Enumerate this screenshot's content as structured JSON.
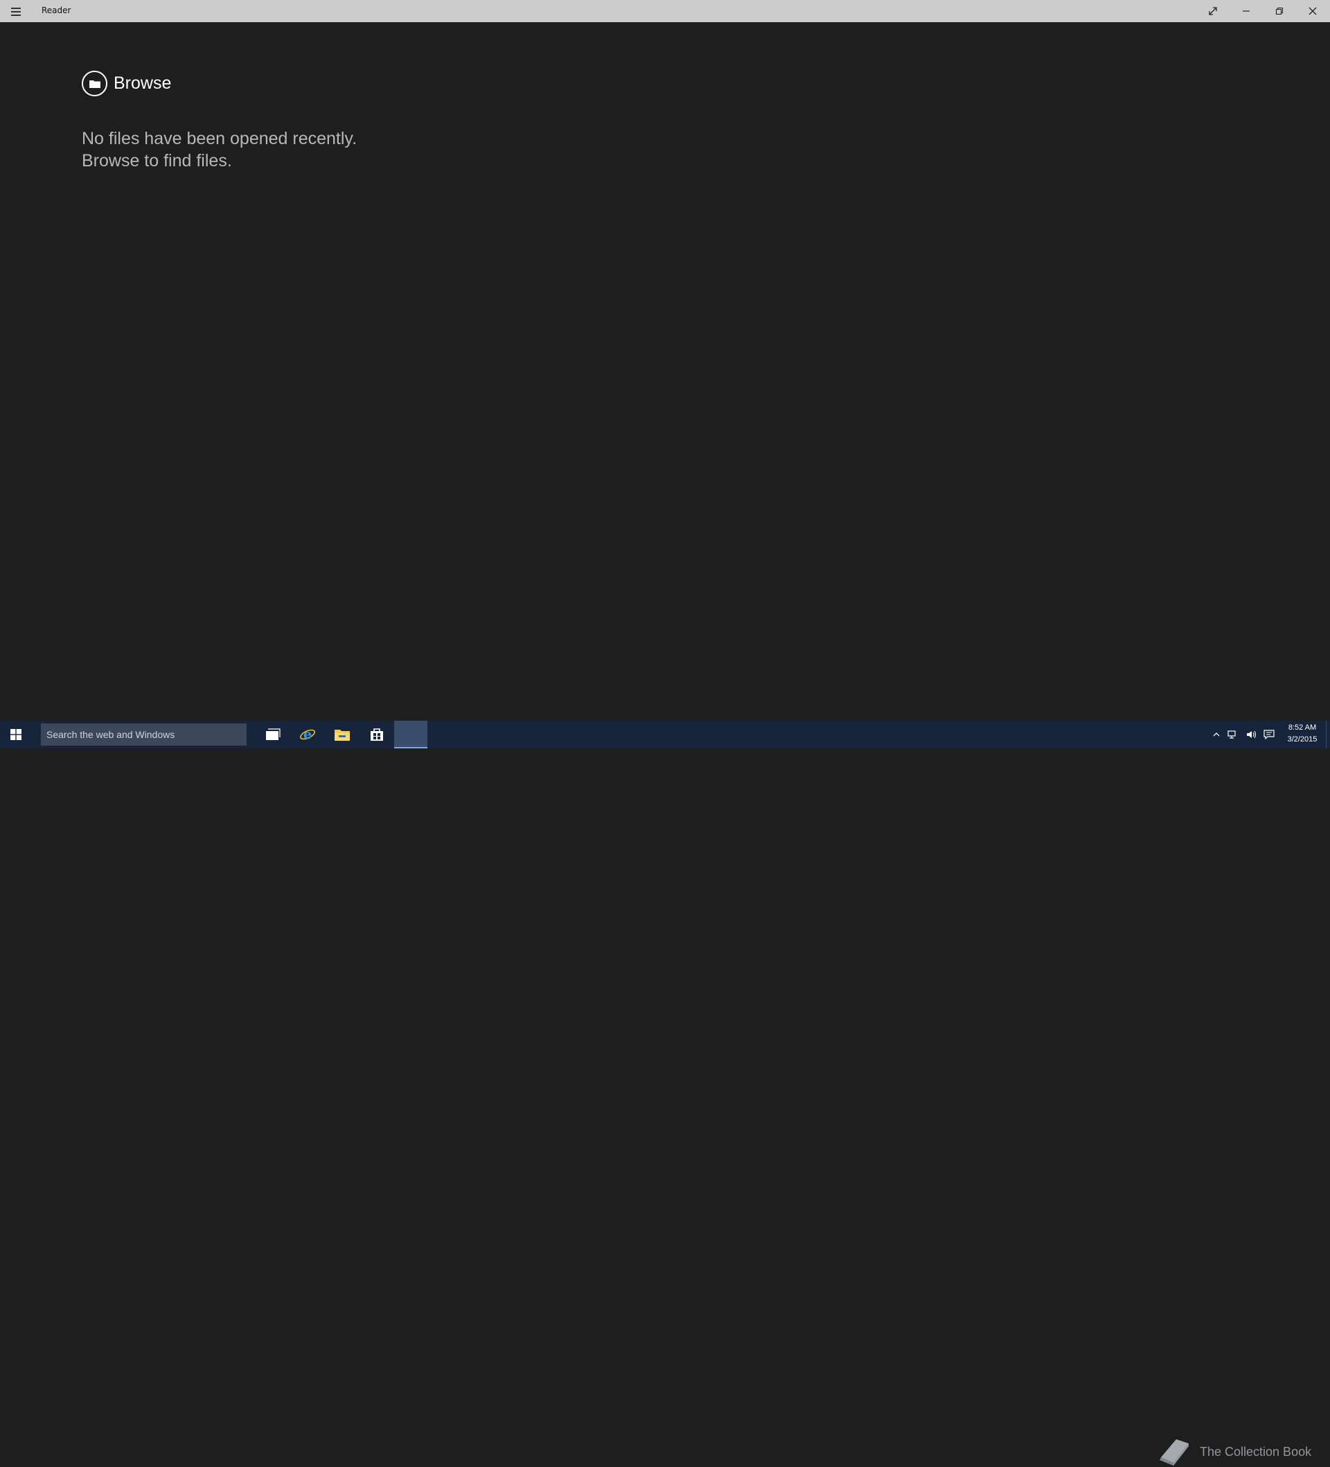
{
  "window": {
    "title": "Reader",
    "controls": {
      "fullscreen_icon": "expand-icon",
      "minimize_icon": "minimize-icon",
      "restore_icon": "restore-icon",
      "close_icon": "close-icon"
    }
  },
  "main": {
    "browse_label": "Browse",
    "browse_icon": "folder-icon",
    "empty_line1": "No files have been opened recently.",
    "empty_line2": "Browse to find files."
  },
  "taskbar": {
    "search_placeholder": "Search the web and Windows",
    "apps": [
      "task-view-icon",
      "internet-explorer-icon",
      "file-explorer-icon",
      "store-icon",
      "reader-app"
    ],
    "watermark_text": "The Collection Book",
    "tray_icons": [
      "chevron-up-icon",
      "network-icon",
      "volume-icon",
      "action-center-icon"
    ],
    "time": "8:52 AM",
    "date": "3/2/2015"
  },
  "colors": {
    "titlebar": "#cccccc",
    "background": "#1e1e1e",
    "taskbar": "#16243c",
    "search_box": "#3c475a"
  }
}
